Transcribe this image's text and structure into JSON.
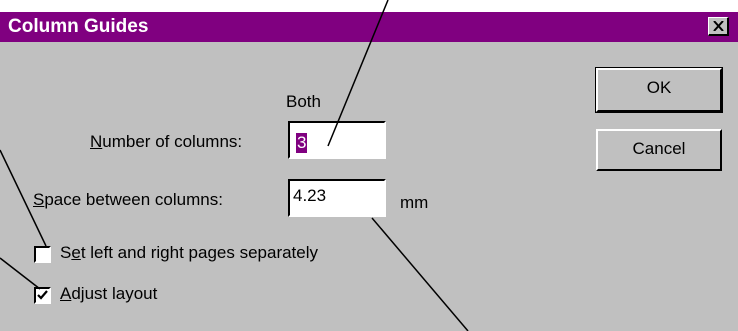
{
  "dialog": {
    "title": "Column Guides",
    "close_icon": "close-icon",
    "both_label": "Both",
    "number_of_columns": {
      "label_mnemonic": "N",
      "label_rest": "umber of columns:",
      "value": "3"
    },
    "space_between_columns": {
      "label_mnemonic": "S",
      "label_rest": "pace between columns:",
      "value": "4.23",
      "unit": "mm"
    },
    "set_left_right": {
      "label_pre": "S",
      "label_mnemonic": "e",
      "label_rest": "t left and right pages separately",
      "checked": false
    },
    "adjust_layout": {
      "label_mnemonic": "A",
      "label_rest": "djust layout",
      "checked": true
    },
    "ok_label": "OK",
    "cancel_label": "Cancel"
  },
  "colors": {
    "titlebar": "#800080",
    "dialog_bg": "#c0c0c0",
    "selection": "#800080"
  }
}
